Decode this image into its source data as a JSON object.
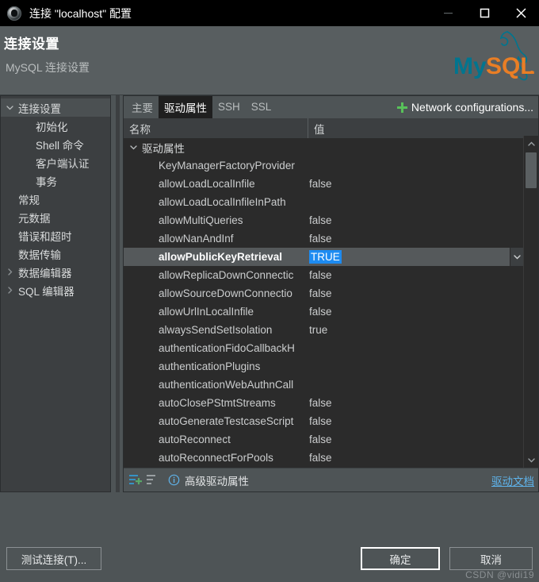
{
  "window": {
    "title": "连接 \"localhost\" 配置",
    "icon": "datagrip-icon",
    "controls": {
      "minimize": "—",
      "maximize": "□",
      "close": "✕"
    }
  },
  "banner": {
    "heading": "连接设置",
    "subheading": "MySQL 连接设置",
    "logo_text_1": "My",
    "logo_text_2": "SQL",
    "logo_color_1": "#00758f",
    "logo_color_2": "#e97e25"
  },
  "sidebar": {
    "items": [
      {
        "label": "连接设置",
        "indent": 0,
        "twisty": "chevron-down-icon",
        "selected": true
      },
      {
        "label": "初始化",
        "indent": 1,
        "twisty": "none",
        "selected": false
      },
      {
        "label": "Shell 命令",
        "indent": 1,
        "twisty": "none",
        "selected": false
      },
      {
        "label": "客户端认证",
        "indent": 1,
        "twisty": "none",
        "selected": false
      },
      {
        "label": "事务",
        "indent": 1,
        "twisty": "none",
        "selected": false
      },
      {
        "label": "常规",
        "indent": 0,
        "twisty": "none",
        "selected": false
      },
      {
        "label": "元数据",
        "indent": 0,
        "twisty": "none",
        "selected": false
      },
      {
        "label": "错误和超时",
        "indent": 0,
        "twisty": "none",
        "selected": false
      },
      {
        "label": "数据传输",
        "indent": 0,
        "twisty": "none",
        "selected": false
      },
      {
        "label": "数据编辑器",
        "indent": 0,
        "twisty": "chevron-right-icon",
        "selected": false
      },
      {
        "label": "SQL 编辑器",
        "indent": 0,
        "twisty": "chevron-right-icon",
        "selected": false
      }
    ]
  },
  "panel": {
    "tabs": [
      {
        "label": "主要",
        "active": false
      },
      {
        "label": "驱动属性",
        "active": true
      },
      {
        "label": "SSH",
        "active": false
      },
      {
        "label": "SSL",
        "active": false
      }
    ],
    "network_link": "Network configurations...",
    "columns": {
      "name": "名称",
      "value": "值"
    },
    "group": {
      "label": "驱动属性",
      "expanded": true
    },
    "rows": [
      {
        "name": "KeyManagerFactoryProvider",
        "value": ""
      },
      {
        "name": "allowLoadLocalInfile",
        "value": "false"
      },
      {
        "name": "allowLoadLocalInfileInPath",
        "value": ""
      },
      {
        "name": "allowMultiQueries",
        "value": "false"
      },
      {
        "name": "allowNanAndInf",
        "value": "false"
      },
      {
        "name": "allowPublicKeyRetrieval",
        "value": "TRUE",
        "selected": true,
        "editing": true
      },
      {
        "name": "allowReplicaDownConnectic",
        "value": "false"
      },
      {
        "name": "allowSourceDownConnectio",
        "value": "false"
      },
      {
        "name": "allowUrlInLocalInfile",
        "value": "false"
      },
      {
        "name": "alwaysSendSetIsolation",
        "value": "true"
      },
      {
        "name": "authenticationFidoCallbackH",
        "value": ""
      },
      {
        "name": "authenticationPlugins",
        "value": ""
      },
      {
        "name": "authenticationWebAuthnCall",
        "value": ""
      },
      {
        "name": "autoClosePStmtStreams",
        "value": "false"
      },
      {
        "name": "autoGenerateTestcaseScript",
        "value": "false"
      },
      {
        "name": "autoReconnect",
        "value": "false"
      },
      {
        "name": "autoReconnectForPools",
        "value": "false"
      }
    ],
    "footer": {
      "add_icon": "add-property-icon",
      "remove_icon": "remove-property-icon",
      "info_icon": "info-icon",
      "label": "高级驱动属性",
      "doc_link": "驱动文档"
    }
  },
  "footer": {
    "test_button": "测试连接(T)...",
    "ok_button": "确定",
    "cancel_button": "取消",
    "watermark": "CSDN @vidi19"
  }
}
